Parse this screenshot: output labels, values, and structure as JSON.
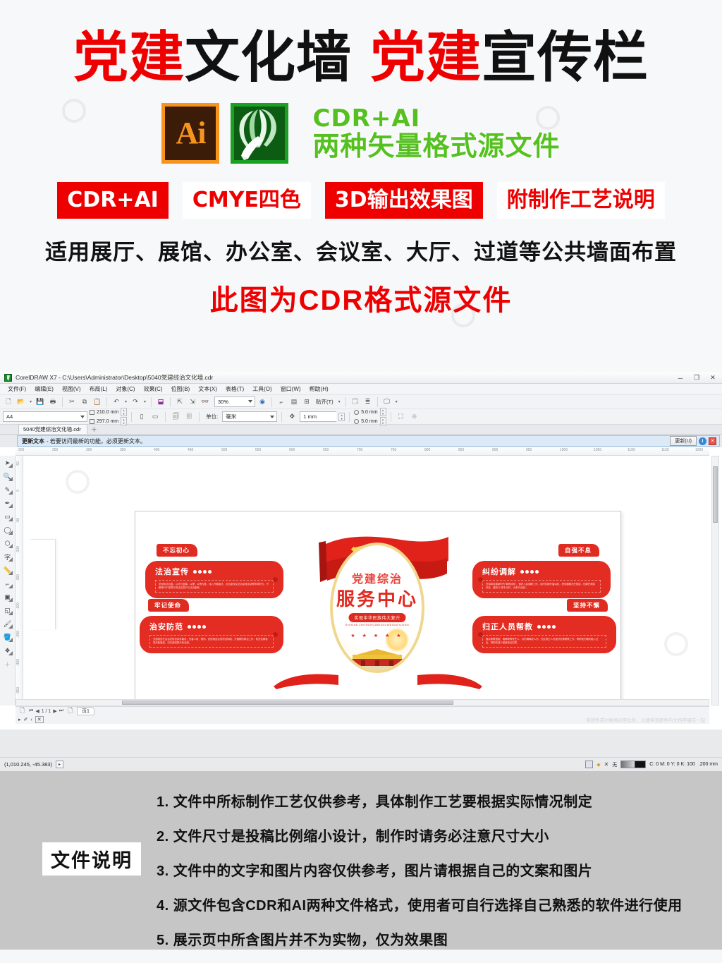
{
  "promo": {
    "title": [
      {
        "text": "党建",
        "color": "red"
      },
      {
        "text": "文化墙",
        "color": "black"
      },
      {
        "text": "党建",
        "color": "red"
      },
      {
        "text": "宣传栏",
        "color": "black"
      }
    ],
    "ai_icon_label": "Ai",
    "format_line1": "CDR+AI",
    "format_line2": "两种矢量格式源文件",
    "format_color": "#55c120",
    "badges": [
      {
        "label": "CDR+AI",
        "style": "fill"
      },
      {
        "label": "CMYE四色",
        "style": "outline"
      },
      {
        "label": "3D输出效果图",
        "style": "fill"
      },
      {
        "label": "附制作工艺说明",
        "style": "outline"
      }
    ],
    "subline": "适用展厅、展馆、办公室、会议室、大厅、过道等公共墙面布置",
    "redline": "此图为CDR格式源文件",
    "accent_red": "#ee0000"
  },
  "app": {
    "title": "CorelDRAW X7 - C:\\Users\\Administrator\\Desktop\\5040党建综治文化墙.cdr",
    "window_buttons": {
      "minimize": "─",
      "restore": "❐",
      "close": "✕"
    },
    "menu": [
      "文件(F)",
      "编辑(E)",
      "视图(V)",
      "布局(L)",
      "对象(C)",
      "效果(C)",
      "位图(B)",
      "文本(X)",
      "表格(T)",
      "工具(O)",
      "窗口(W)",
      "帮助(H)"
    ],
    "toolbar": {
      "zoom_level": "30%",
      "align_label": "贴齐(T)"
    },
    "property_bar": {
      "paper_size": "A4",
      "width": "210.0 mm",
      "height": "297.0 mm",
      "units_label": "单位:",
      "units_value": "毫米",
      "nudge": "1 mm",
      "duplicate_x": "5.0 mm",
      "duplicate_y": "5.0 mm"
    },
    "document_tab": "5040党建综治文化墙.cdr",
    "notification": {
      "strong": "更新文本",
      "text": "-  若要访问最新的功能，必须更新文本。",
      "button": "更新(U)",
      "info_icon": "i",
      "close_icon": "✕"
    },
    "toolbox": [
      {
        "name": "pick-tool",
        "glyph": "➤"
      },
      {
        "name": "zoom-tool",
        "glyph": "🔍"
      },
      {
        "name": "freehand-tool",
        "glyph": "✎"
      },
      {
        "name": "smart-fill-tool",
        "glyph": "✒"
      },
      {
        "name": "rectangle-tool",
        "glyph": "▭"
      },
      {
        "name": "ellipse-tool",
        "glyph": "◯"
      },
      {
        "name": "polygon-tool",
        "glyph": "⬡"
      },
      {
        "name": "text-tool",
        "glyph": "字"
      },
      {
        "name": "dimension-tool",
        "glyph": "📏"
      },
      {
        "name": "connector-tool",
        "glyph": "⌐"
      },
      {
        "name": "shadow-tool",
        "glyph": "▣"
      },
      {
        "name": "transparency-tool",
        "glyph": "◱"
      },
      {
        "name": "color-eyedropper-tool",
        "glyph": "🖌"
      },
      {
        "name": "fill-tool",
        "glyph": "🪣"
      },
      {
        "name": "interactive-fill-tool",
        "glyph": "❖"
      },
      {
        "name": "add-tool",
        "glyph": "＋"
      }
    ],
    "ruler": {
      "h_ticks": [
        "200",
        "250",
        "300",
        "350",
        "400",
        "450",
        "500",
        "550",
        "600",
        "650",
        "700",
        "750",
        "800",
        "850",
        "900",
        "950",
        "1000",
        "1050",
        "1100",
        "1150",
        "1200"
      ],
      "v_ticks": [
        "50",
        "0",
        "-50",
        "-100",
        "-150",
        "-200",
        "-250",
        "-300",
        "-350"
      ]
    },
    "status": {
      "page_indicator": "1 / 1",
      "page_tab": "页1",
      "coordinates": "(1,010.245, -45.383)",
      "palette_hint": "将颜色或对象拖动至此处，以便将该颜色与文档存储在一起",
      "fill_none": "无",
      "outline_cmyk": "C: 0 M: 0 Y: 0 K: 100",
      "outline_width": ".200 mm"
    }
  },
  "artwork": {
    "center_title_top": "党建综治",
    "center_title_main": "服务中心",
    "center_pill": "实现中华民族伟大复兴",
    "center_pinyin": "SHIXIAN ZHONGHUAMINZUWEIDAFUXING",
    "center_stars": "★ ★ ★ ★ ★",
    "tags": [
      {
        "label": "不忘初心",
        "pos": "left-top"
      },
      {
        "label": "牢记使命",
        "pos": "left-bottom"
      },
      {
        "label": "自强不息",
        "pos": "right-top"
      },
      {
        "label": "坚持不懈",
        "pos": "right-bottom"
      }
    ],
    "cards": [
      {
        "heading": "法治宣传",
        "body": "坚持依法治国，以法为准绳，以理、以情为基，深入开展普法、法治宣传及法治实践活动等多种形式，不断提升干部群众的法治意识与法治素养。",
        "pos": "left-top"
      },
      {
        "heading": "治安防范",
        "body": "全面推进社会治安防控体系建设，完善人防、物防、技防相结合的防范网络，开展群防群治工作，防范化解各类风险隐患，切实增强群众安全感。",
        "pos": "left-bottom"
      },
      {
        "heading": "纠纷调解",
        "body": "坚持和发展新时代\"枫桥经验\"，做好人民调解工作，及时化解矛盾纠纷，把问题解决在基层、化解在萌芽状态，做到\"小事不出村、大事不出镇\"。",
        "pos": "right-top"
      },
      {
        "heading": "归正人员帮教",
        "body": "落实帮教措施，明确帮教责任人，对刑满释放人员、社区矫正人员做好安置帮教工作，帮助他们顺利融入社会，预防和减少重新违法犯罪。",
        "pos": "right-bottom"
      }
    ]
  },
  "description": {
    "label": "文件说明",
    "items": [
      "1. 文件中所标制作工艺仅供参考，具体制作工艺要根据实际情况制定",
      "2. 文件尺寸是投稿比例缩小设计，制作时请务必注意尺寸大小",
      "3. 文件中的文字和图片内容仅供参考，图片请根据自己的文案和图片",
      "4. 源文件包含CDR和AI两种文件格式，使用者可自行选择自己熟悉的软件进行使用",
      "5. 展示页中所含图片并不为实物，仅为效果图"
    ]
  }
}
